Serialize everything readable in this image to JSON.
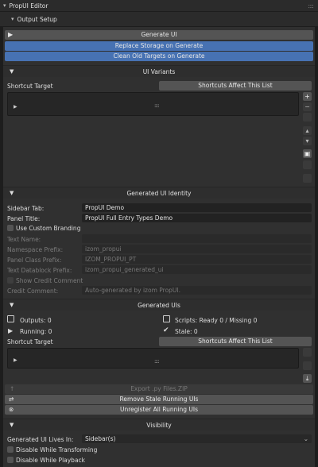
{
  "panel": {
    "title": "PropUI Editor"
  },
  "output_setup": {
    "title": "Output Setup",
    "generate_label": "Generate UI",
    "replace_storage_label": "Replace Storage on Generate",
    "clean_targets_label": "Clean Old Targets on Generate"
  },
  "ui_variants": {
    "title": "UI Variants",
    "shortcut_target_label": "Shortcut Target",
    "shortcuts_button": "Shortcuts Affect This List"
  },
  "identity": {
    "title": "Generated UI Identity",
    "sidebar_tab_label": "Sidebar Tab:",
    "sidebar_tab_value": "PropUI Demo",
    "panel_title_label": "Panel Title:",
    "panel_title_value": "PropUI Full Entry Types Demo",
    "custom_branding_label": "Use Custom Branding",
    "text_name_label": "Text Name:",
    "namespace_prefix_label": "Namespace Prefix:",
    "namespace_prefix_value": "izom_propui",
    "panel_class_prefix_label": "Panel Class Prefix:",
    "panel_class_prefix_value": "IZOM_PROPUI_PT",
    "text_datablock_prefix_label": "Text Datablock Prefix:",
    "text_datablock_prefix_value": "izom_propui_generated_ui",
    "show_credit_label": "Show Credit Comment",
    "credit_comment_label": "Credit Comment:",
    "credit_comment_value": "Auto-generated by izom PropUI."
  },
  "generated_uis": {
    "title": "Generated UIs",
    "outputs_label": "Outputs: 0",
    "scripts_label": "Scripts: Ready 0 / Missing 0",
    "running_label": "Running: 0",
    "stale_label": "Stale: 0",
    "shortcut_target_label": "Shortcut Target",
    "shortcuts_button": "Shortcuts Affect This List",
    "export_label": "Export .py Files.ZIP",
    "remove_stale_label": "Remove Stale Running UIs",
    "unregister_label": "Unregister All Running UIs"
  },
  "visibility": {
    "title": "Visibility",
    "lives_in_label": "Generated UI Lives In:",
    "lives_in_value": "Sidebar(s)",
    "disable_transforming_label": "Disable While Transforming",
    "disable_playback_label": "Disable While Playback"
  }
}
